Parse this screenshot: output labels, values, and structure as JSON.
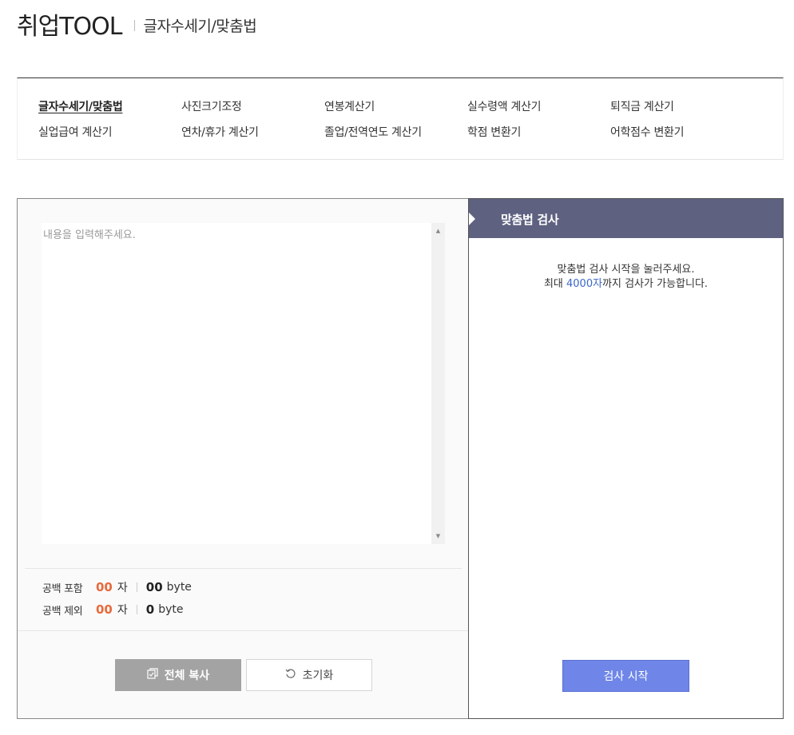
{
  "header": {
    "brand": "취업TOOL",
    "subtitle": "글자수세기/맞춤법"
  },
  "nav": {
    "items": [
      {
        "label": "글자수세기/맞춤법",
        "active": true
      },
      {
        "label": "사진크기조정"
      },
      {
        "label": "연봉계산기"
      },
      {
        "label": "실수령액 계산기"
      },
      {
        "label": "퇴직금 계산기"
      },
      {
        "label": "실업급여 계산기"
      },
      {
        "label": "연차/휴가 계산기"
      },
      {
        "label": "졸업/전역연도 계산기"
      },
      {
        "label": "학점 변환기"
      },
      {
        "label": "어학점수 변환기"
      }
    ]
  },
  "editor": {
    "placeholder": "내용을 입력해주세요.",
    "value": ""
  },
  "counts": {
    "with_space": {
      "label": "공백 포함",
      "chars": "00",
      "char_unit": "자",
      "bytes": "00",
      "byte_unit": "byte"
    },
    "without_space": {
      "label": "공백 제외",
      "chars": "00",
      "char_unit": "자",
      "bytes": "0",
      "byte_unit": "byte"
    }
  },
  "buttons": {
    "copy": "전체 복사",
    "reset": "초기화",
    "check": "검사 시작"
  },
  "spellcheck": {
    "title": "맞춤법 검사",
    "line1": "맞춤법 검사 시작을 눌러주세요.",
    "line2_prefix": "최대 ",
    "line2_limit": "4000자",
    "line2_suffix": "까지 검사가 가능합니다."
  },
  "colors": {
    "accent_blue": "#3c67c8",
    "count_orange": "#e86a3c",
    "panel_header": "#5e6180",
    "check_button": "#6f86e8",
    "copy_button": "#a3a3a3"
  }
}
